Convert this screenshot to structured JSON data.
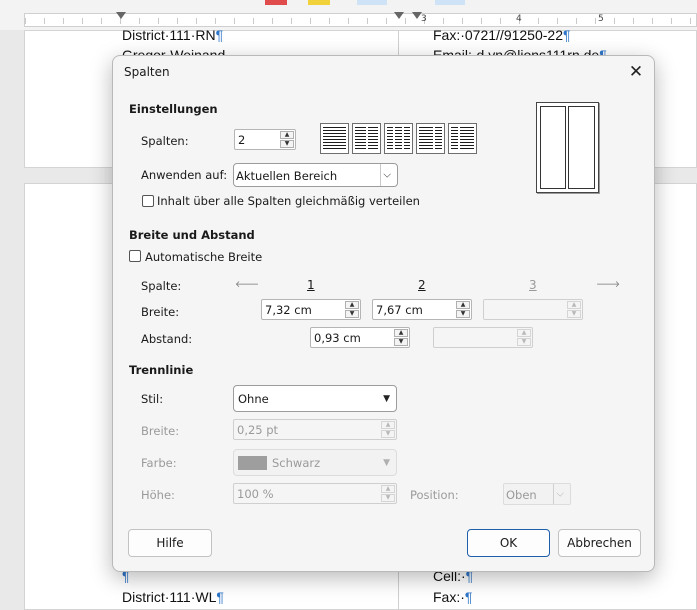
{
  "document": {
    "ruler_numbers": [
      "3",
      "4",
      "5"
    ],
    "text_top_left_1": "District·111·RN",
    "text_top_left_2": "Gregor·Weinand",
    "text_top_right_1": "Fax:·0721//91250-22",
    "text_top_right_2": "Email:·d.vn@lions111rn.de",
    "text_bottom_left_1": "",
    "text_bottom_left_2": "District·111·WL",
    "text_bottom_right_1": "Cell:·",
    "text_bottom_right_2": "Fax:·",
    "pilcrow": "¶"
  },
  "dialog": {
    "title": "Spalten",
    "close_glyph": "✕",
    "settings": {
      "heading": "Einstellungen",
      "columns_label": "Spalten:",
      "columns_value": "2",
      "apply_label": "Anwenden auf:",
      "apply_value": "Aktuellen Bereich",
      "evenly_label": "Inhalt über alle Spalten gleichmäßig verteilen"
    },
    "width_spacing": {
      "heading": "Breite und Abstand",
      "auto_width_label": "Automatische Breite",
      "column_label": "Spalte:",
      "column_numbers": [
        "1",
        "2",
        "3"
      ],
      "width_label": "Breite:",
      "width_values": [
        "7,32 cm",
        "7,67 cm",
        ""
      ],
      "spacing_label": "Abstand:",
      "spacing_values": [
        "0,93 cm",
        ""
      ]
    },
    "separator": {
      "heading": "Trennlinie",
      "style_label": "Stil:",
      "style_value": "Ohne",
      "width_label": "Breite:",
      "width_value": "0,25 pt",
      "color_label": "Farbe:",
      "color_value": "Schwarz",
      "color_swatch": "#9e9e9e",
      "height_label": "Höhe:",
      "height_value": "100 %",
      "position_label": "Position:",
      "position_value": "Oben"
    },
    "buttons": {
      "help": "Hilfe",
      "ok": "OK",
      "cancel": "Abbrechen"
    },
    "accent_color": "#1f5ea8"
  }
}
